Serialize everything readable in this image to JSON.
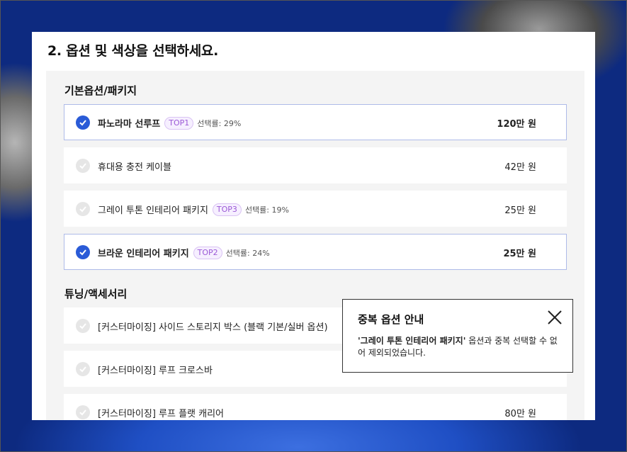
{
  "page_title": "2. 옵션 및 색상을 선택하세요.",
  "sections": [
    {
      "title": "기본옵션/패키지",
      "options": [
        {
          "name": "파노라마 선루프",
          "badge": "TOP1",
          "rate": "선택률: 29%",
          "price_num": "120",
          "price_unit": "만 원",
          "selected": true
        },
        {
          "name": "휴대용 충전 케이블",
          "badge": "",
          "rate": "",
          "price_num": "42",
          "price_unit": "만 원",
          "selected": false
        },
        {
          "name": "그레이 투톤 인테리어 패키지",
          "badge": "TOP3",
          "rate": "선택률: 19%",
          "price_num": "25",
          "price_unit": "만 원",
          "selected": false
        },
        {
          "name": "브라운 인테리어 패키지",
          "badge": "TOP2",
          "rate": "선택률: 24%",
          "price_num": "25",
          "price_unit": "만 원",
          "selected": true
        }
      ]
    },
    {
      "title": "튜닝/액세서리",
      "options": [
        {
          "name": "[커스터마이징] 사이드 스토리지 박스 (블랙 기본/실버 옵션)",
          "badge": "",
          "rate": "",
          "price_num": "",
          "price_unit": "",
          "selected": false
        },
        {
          "name": "[커스터마이징] 루프 크로스바",
          "badge": "",
          "rate": "",
          "price_num": "",
          "price_unit": "",
          "selected": false
        },
        {
          "name": "[커스터마이징] 루프 플랫 캐리어",
          "badge": "",
          "rate": "",
          "price_num": "80",
          "price_unit": "만 원",
          "selected": false
        }
      ]
    }
  ],
  "popup": {
    "title": "중복 옵션 안내",
    "highlight": "'그레이 투톤 인테리어 패키지'",
    "message": " 옵션과 중복 선택할 수 없어 제외되었습니다."
  },
  "colors": {
    "accent": "#2a5bd7",
    "badge_text": "#9b59d6",
    "badge_border": "#d9c3f3"
  },
  "icons": {
    "check": "check-icon",
    "close": "close-icon"
  }
}
